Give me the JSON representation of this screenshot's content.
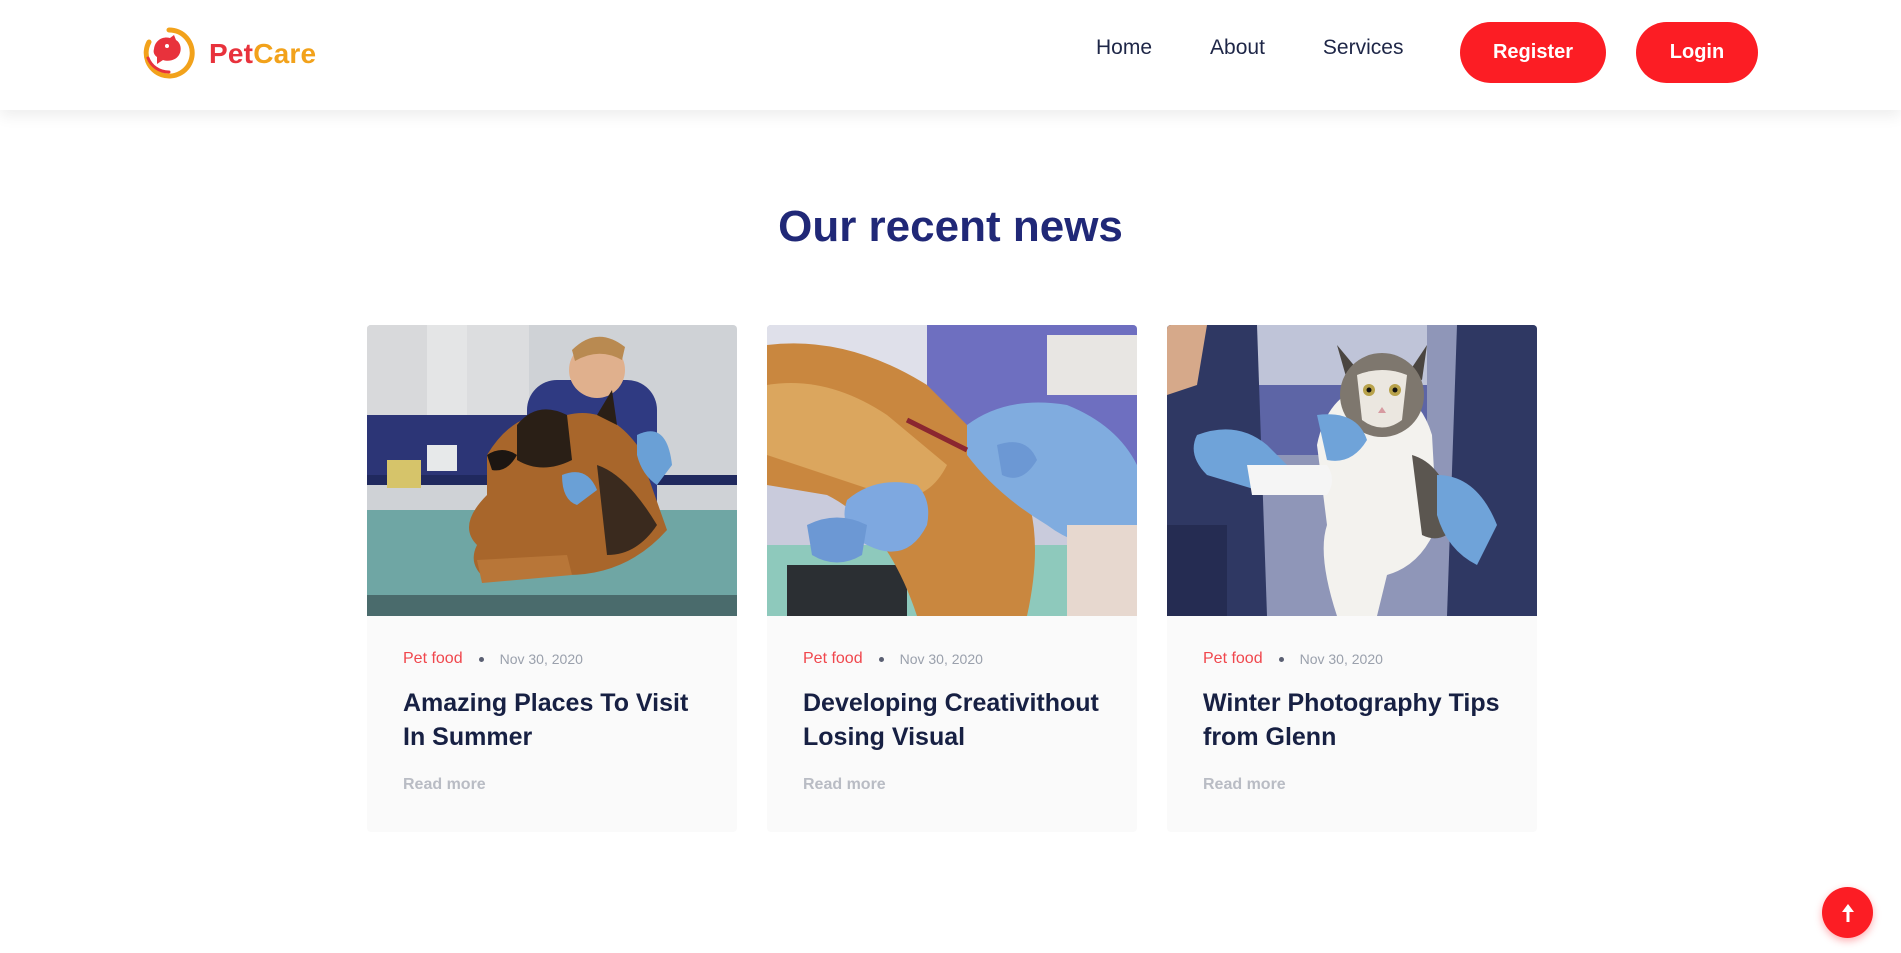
{
  "brand": {
    "name_part1": "Pet",
    "name_part2": "Care"
  },
  "nav": {
    "items": [
      "Home",
      "About",
      "Services"
    ]
  },
  "auth": {
    "register_label": "Register",
    "login_label": "Login"
  },
  "news": {
    "title": "Our recent news",
    "cards": [
      {
        "category": "Pet food",
        "date": "Nov 30, 2020",
        "title": "Amazing Places To Visit In Summer",
        "read_more": "Read more",
        "image": "vet-examining-german-shepherd"
      },
      {
        "category": "Pet food",
        "date": "Nov 30, 2020",
        "title": "Developing Creativithout Losing Visual",
        "read_more": "Read more",
        "image": "vet-drawing-blood-from-dog-leg"
      },
      {
        "category": "Pet food",
        "date": "Nov 30, 2020",
        "title": "Winter Photography Tips from Glenn",
        "read_more": "Read more",
        "image": "vets-holding-bandaged-cat"
      }
    ]
  },
  "colors": {
    "accent": "#fc1d24",
    "brand_red": "#e8323c",
    "brand_orange": "#f2a21b",
    "heading": "#202877",
    "card_title": "#172043"
  },
  "icons": {
    "scroll_top": "arrow-up-icon",
    "logo": "petcare-logo-icon"
  }
}
